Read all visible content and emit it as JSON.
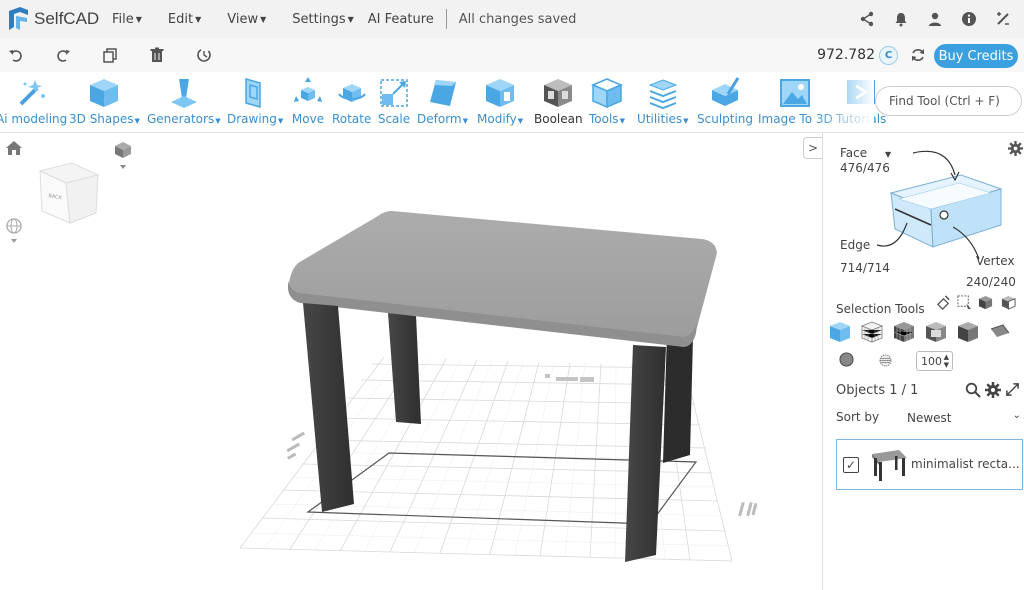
{
  "app": {
    "name": "SelfCAD"
  },
  "menu": {
    "items": [
      "File",
      "Edit",
      "View",
      "Settings"
    ],
    "ai_feature": "AI Feature",
    "status": "All changes saved"
  },
  "credits": {
    "value": "972.782",
    "badge": "C",
    "buy_label": "Buy Credits"
  },
  "tools": [
    {
      "label": "Ai modeling",
      "caret": false
    },
    {
      "label": "3D Shapes",
      "caret": true
    },
    {
      "label": "Generators",
      "caret": true
    },
    {
      "label": "Drawing",
      "caret": true
    },
    {
      "label": "Move",
      "caret": false
    },
    {
      "label": "Rotate",
      "caret": false
    },
    {
      "label": "Scale",
      "caret": false
    },
    {
      "label": "Deform",
      "caret": true
    },
    {
      "label": "Modify",
      "caret": true
    },
    {
      "label": "Boolean",
      "caret": false
    },
    {
      "label": "Tools",
      "caret": true
    },
    {
      "label": "Utilities",
      "caret": true
    },
    {
      "label": "Sculpting",
      "caret": false
    },
    {
      "label": "Image To 3D",
      "caret": false
    },
    {
      "label": "Tutorials",
      "caret": false
    }
  ],
  "find_tool": {
    "placeholder": "Find Tool (Ctrl + F)"
  },
  "nav_cube": {
    "face_label": "BACK"
  },
  "selection": {
    "face_label": "Face",
    "face_count": "476/476",
    "edge_label": "Edge",
    "edge_count": "714/714",
    "vertex_label": "Vertex",
    "vertex_count": "240/240",
    "tools_label": "Selection Tools",
    "brush_size": "100"
  },
  "objects": {
    "label": "Objects 1 / 1",
    "sort_label": "Sort by",
    "sort_value": "Newest",
    "items": [
      {
        "name": "minimalist recta...",
        "checked": true
      }
    ]
  },
  "colors": {
    "accent": "#3aa0df",
    "tool_blue": "#3a8fcf",
    "table_top": "#a3a3a3",
    "table_legs": "#3a3a3a"
  }
}
